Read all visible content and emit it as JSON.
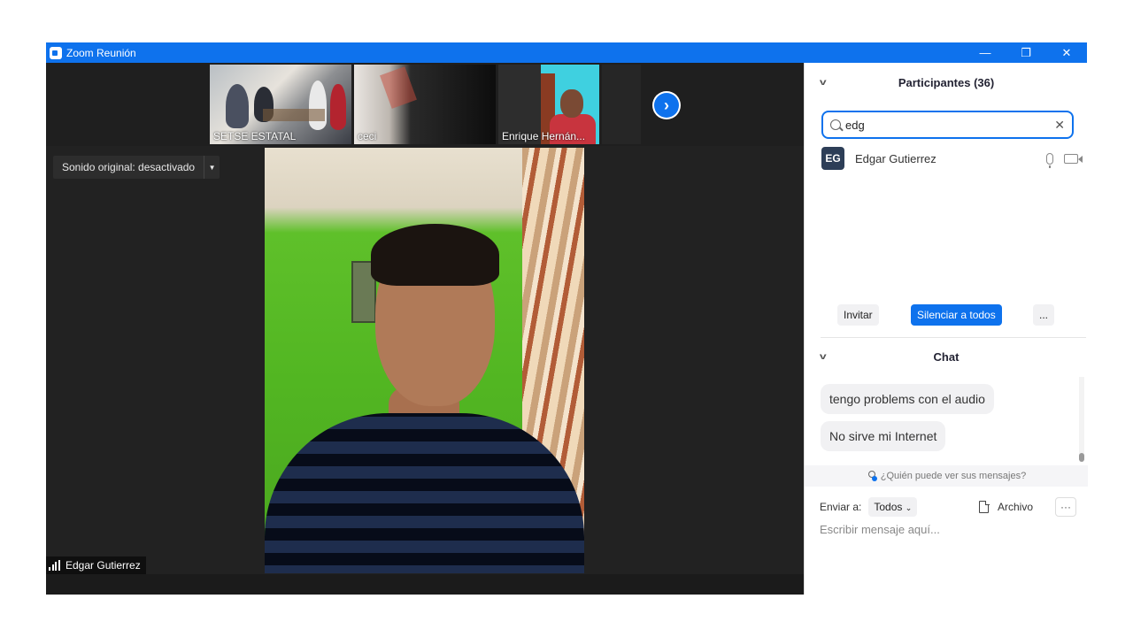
{
  "window": {
    "title": "Zoom Reunión",
    "minimize": "—",
    "restore": "❐",
    "close": "✕"
  },
  "thumbnails": [
    {
      "label": "SETSE ESTATAL"
    },
    {
      "label": "ceci"
    },
    {
      "label": "Enrique Hernán..."
    }
  ],
  "next_icon": "chevron-right-icon",
  "sound_button": {
    "label": "Sonido original: desactivado",
    "arrow": "▼"
  },
  "active_speaker": {
    "name": "Edgar Gutierrez"
  },
  "participants_panel": {
    "title": "Participantes (36)",
    "search_value": "edg",
    "clear": "✕",
    "list": [
      {
        "initials": "EG",
        "name": "Edgar Gutierrez"
      }
    ],
    "buttons": {
      "invite": "Invitar",
      "mute_all": "Silenciar a todos",
      "more": "..."
    }
  },
  "chat_panel": {
    "title": "Chat",
    "messages": [
      {
        "text": "tengo problems con el audio"
      },
      {
        "text": "No sirve mi Internet"
      }
    ],
    "visibility_text": "¿Quién puede ver sus mensajes?",
    "send_to_label": "Enviar a:",
    "send_to_value": "Todos",
    "file_label": "Archivo",
    "more": "···",
    "input_placeholder": "Escribir mensaje aquí..."
  },
  "colors": {
    "accent": "#0e72ed",
    "dark": "#1a1a1a"
  }
}
